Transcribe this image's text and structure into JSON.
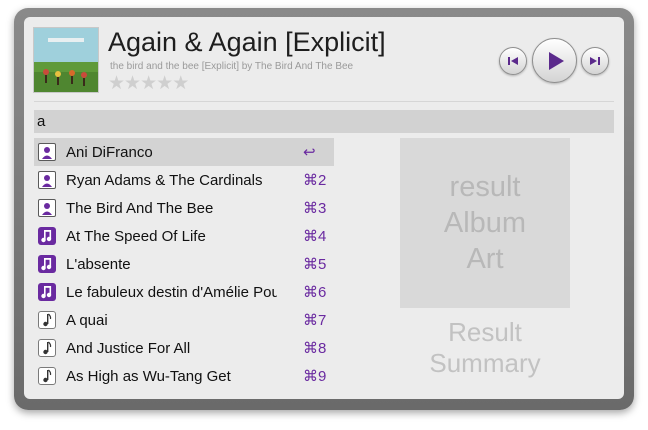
{
  "now_playing": {
    "title": "Again & Again [Explicit]",
    "subtitle": "the bird and the bee [Explicit] by The Bird And The Bee",
    "rating_stars": 0,
    "star_glyphs": [
      "★",
      "★",
      "★",
      "★",
      "★"
    ]
  },
  "controls": {
    "previous_icon": "skip-previous-icon",
    "play_icon": "play-icon",
    "next_icon": "skip-next-icon",
    "accent_color": "#5b2a8c"
  },
  "search": {
    "query": "a"
  },
  "results": [
    {
      "type": "artist",
      "icon": "artist-icon",
      "label": "Ani DiFranco",
      "shortcut": "↩",
      "selected": true
    },
    {
      "type": "artist",
      "icon": "artist-icon",
      "label": "Ryan Adams & The Cardinals",
      "shortcut": "⌘2",
      "selected": false
    },
    {
      "type": "artist",
      "icon": "artist-icon",
      "label": "The Bird And The Bee",
      "shortcut": "⌘3",
      "selected": false
    },
    {
      "type": "album",
      "icon": "album-icon",
      "label": "At The Speed Of Life",
      "shortcut": "⌘4",
      "selected": false
    },
    {
      "type": "album",
      "icon": "album-icon",
      "label": "L'absente",
      "shortcut": "⌘5",
      "selected": false
    },
    {
      "type": "album",
      "icon": "album-icon",
      "label": "Le fabuleux destin d'Amélie Poulain",
      "shortcut": "⌘6",
      "selected": false
    },
    {
      "type": "track",
      "icon": "music-note-icon",
      "label": "A quai",
      "shortcut": "⌘7",
      "selected": false
    },
    {
      "type": "track",
      "icon": "music-note-icon",
      "label": "And Justice For All",
      "shortcut": "⌘8",
      "selected": false
    },
    {
      "type": "track",
      "icon": "music-note-icon",
      "label": "As High as Wu-Tang Get",
      "shortcut": "⌘9",
      "selected": false
    }
  ],
  "preview": {
    "art_placeholder": "result\nAlbum\nArt",
    "summary_placeholder": "Result\nSummary"
  },
  "colors": {
    "shortcut": "#6a2aa0",
    "selected_row": "#d3d3d3",
    "album_icon": "#6a2aa0"
  }
}
